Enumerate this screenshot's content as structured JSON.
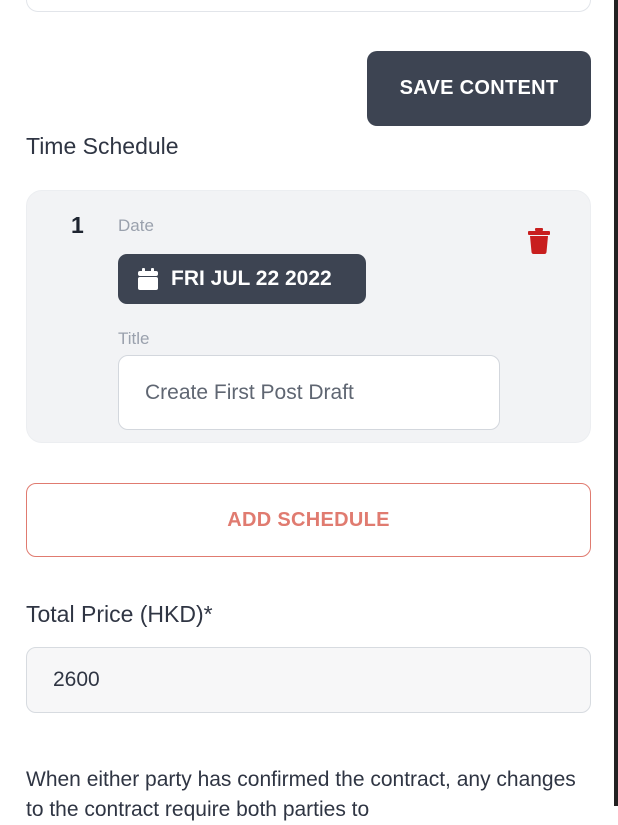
{
  "toolbar": {
    "save_label": "SAVE CONTENT"
  },
  "schedule": {
    "section_title": "Time Schedule",
    "items": [
      {
        "index": "1",
        "date_label": "Date",
        "date_value": "FRI JUL 22 2022",
        "title_label": "Title",
        "title_value": "Create First Post Draft",
        "delete_icon": "trash-icon",
        "date_icon": "calendar-icon"
      }
    ],
    "add_label": "ADD SCHEDULE"
  },
  "price": {
    "label": "Total Price (HKD)*",
    "value": "2600"
  },
  "notice": {
    "text": "When either party has confirmed the contract, any changes to the contract require both parties to"
  },
  "colors": {
    "primary_dark": "#3d4452",
    "danger": "#c81e1e",
    "accent_outline": "#e07b70",
    "card_bg": "#f2f3f5"
  }
}
